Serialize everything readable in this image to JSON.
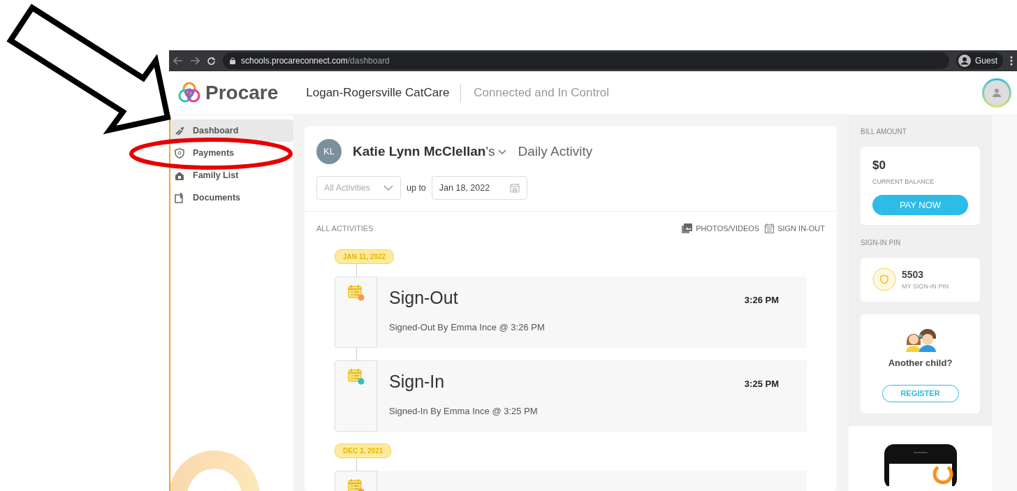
{
  "browser": {
    "url_host": "schools.procareconnect.com",
    "url_path": "/dashboard",
    "profile": "Guest"
  },
  "header": {
    "brand": "Procare",
    "school": "Logan-Rogersville CatCare",
    "tagline": "Connected and In Control"
  },
  "sidebar": {
    "items": [
      {
        "label": "Dashboard",
        "selected": true
      },
      {
        "label": "Payments",
        "selected": false
      },
      {
        "label": "Family List",
        "selected": false
      },
      {
        "label": "Documents",
        "selected": false
      }
    ]
  },
  "activity": {
    "initials": "KL",
    "child_name": "Katie Lynn McClellan",
    "possessive": "'s",
    "title": "Daily Activity",
    "filter": {
      "value": "All Activities"
    },
    "up_to": "up to",
    "date": "Jan 18, 2022",
    "section_label": "ALL ACTIVITIES",
    "links": [
      "PHOTOS/VIDEOS",
      "SIGN IN-OUT"
    ],
    "groups": [
      {
        "date": "JAN 11, 2022",
        "entries": [
          {
            "kind": "sign-out",
            "title": "Sign-Out",
            "time": "3:26 PM",
            "detail": "Signed-Out By Emma Ince @ 3:26 PM"
          },
          {
            "kind": "sign-in",
            "title": "Sign-In",
            "time": "3:25 PM",
            "detail": "Signed-In By Emma Ince @ 3:25 PM"
          }
        ]
      },
      {
        "date": "DEC 3, 2021",
        "entries": [
          {
            "kind": "sign-out"
          }
        ]
      }
    ]
  },
  "side_panel": {
    "bill_label": "BILL AMOUNT",
    "balance": "$0",
    "balance_label": "CURRENT BALANCE",
    "pay_button": "PAY NOW",
    "pin_label": "SIGN-IN PIN",
    "pin": "5503",
    "pin_caption": "MY SIGN-IN PIN",
    "another_child": "Another child?",
    "register_button": "REGISTER"
  },
  "annotations": [
    {
      "kind": "arrow",
      "color": "#000000"
    },
    {
      "kind": "ellipse",
      "color": "#e60000"
    }
  ]
}
